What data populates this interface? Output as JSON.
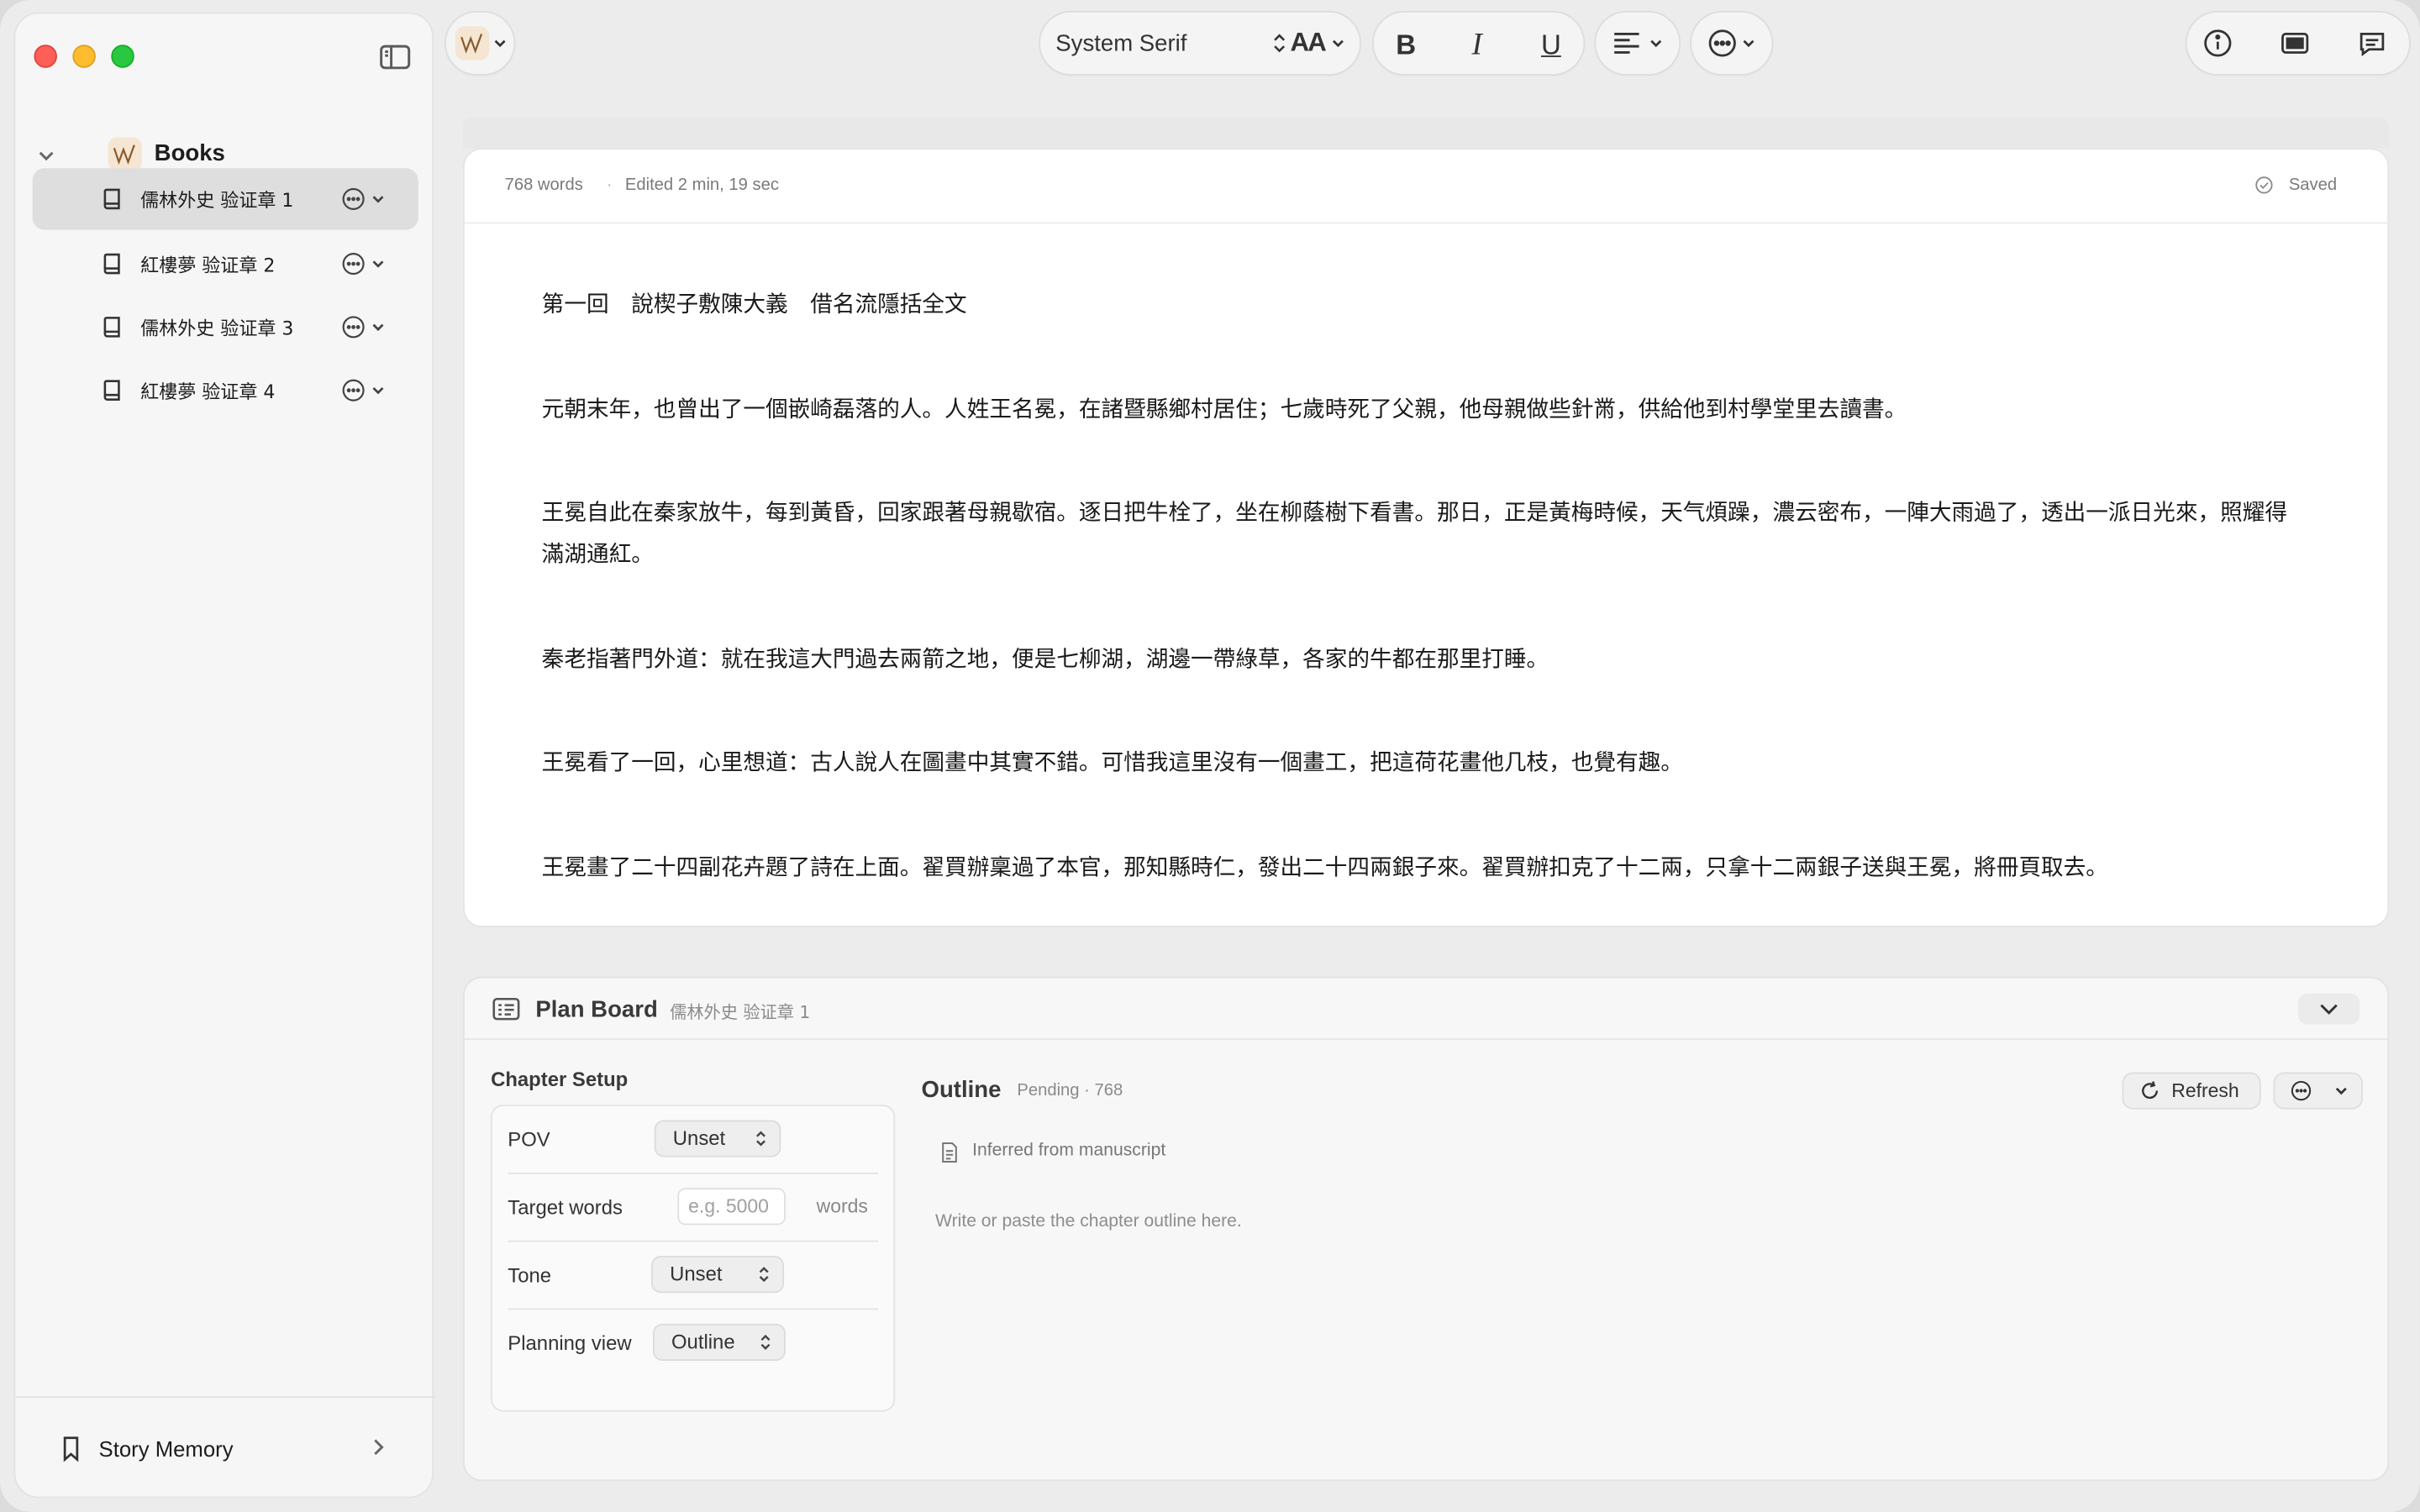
{
  "sidebar": {
    "root_label": "Books",
    "chapters": [
      {
        "label": "儒林外史 验证章 1",
        "selected": true
      },
      {
        "label": "紅樓夢 验证章 2",
        "selected": false
      },
      {
        "label": "儒林外史 验证章 3",
        "selected": false
      },
      {
        "label": "紅樓夢 验证章 4",
        "selected": false
      }
    ],
    "footer_label": "Story Memory"
  },
  "toolbar": {
    "font_name": "System Serif",
    "font_size_label": "AA",
    "bold_label": "B",
    "italic_label": "I",
    "underline_label": "U"
  },
  "editor": {
    "word_count": "768 words",
    "separator": "·",
    "edited": "Edited  2 min, 19 sec",
    "saved_label": "Saved",
    "paragraphs": [
      "第一回　說楔子敷陳大義　借名流隱括全文",
      "元朝末年，也曾出了一個嵌崎磊落的人。人姓王名冕，在諸暨縣鄉村居住；七歲時死了父親，他母親做些針黹，供給他到村學堂里去讀書。",
      "王冕自此在秦家放牛，每到黃昏，回家跟著母親歇宿。逐日把牛栓了，坐在柳蔭樹下看書。那日，正是黃梅時候，天气煩躁，濃云密布，一陣大雨過了，透出一派日光來，照耀得滿湖通紅。",
      "秦老指著門外道：就在我這大門過去兩箭之地，便是七柳湖，湖邊一帶綠草，各家的牛都在那里打睡。",
      "王冕看了一回，心里想道：古人說人在圖畫中其實不錯。可惜我這里沒有一個畫工，把這荷花畫他几枝，也覺有趣。",
      "王冕畫了二十四副花卉題了詩在上面。翟買辦稟過了本官，那知縣時仁，發出二十四兩銀子來。翟買辦扣克了十二兩，只拿十二兩銀子送與王冕，將冊頁取去。"
    ]
  },
  "plan_board": {
    "title": "Plan Board",
    "chapter": "儒林外史 验证章 1",
    "setup_title": "Chapter Setup",
    "pov_label": "POV",
    "pov_value": "Unset",
    "target_label": "Target words",
    "target_placeholder": "e.g. 5000",
    "target_unit": "words",
    "tone_label": "Tone",
    "tone_value": "Unset",
    "planning_label": "Planning view",
    "planning_value": "Outline",
    "outline_title": "Outline",
    "outline_status": "Pending · 768",
    "refresh_label": "Refresh",
    "inferred_label": "Inferred from manuscript",
    "outline_placeholder": "Write or paste the chapter outline here."
  },
  "colors": {
    "close": "#ff5f57",
    "minimize": "#febc2e",
    "zoom": "#28c840",
    "selection": "#dedede"
  },
  "icons": [
    "sidebar-toggle-icon",
    "app-logo-icon",
    "book-icon",
    "ellipsis-circle-icon",
    "chevron-down-icon",
    "bookmark-icon",
    "chevron-right-icon",
    "text-align-icon",
    "info-icon",
    "focus-mode-icon",
    "comment-icon",
    "checkmark-circle-icon",
    "plan-board-icon",
    "refresh-icon",
    "document-icon"
  ]
}
